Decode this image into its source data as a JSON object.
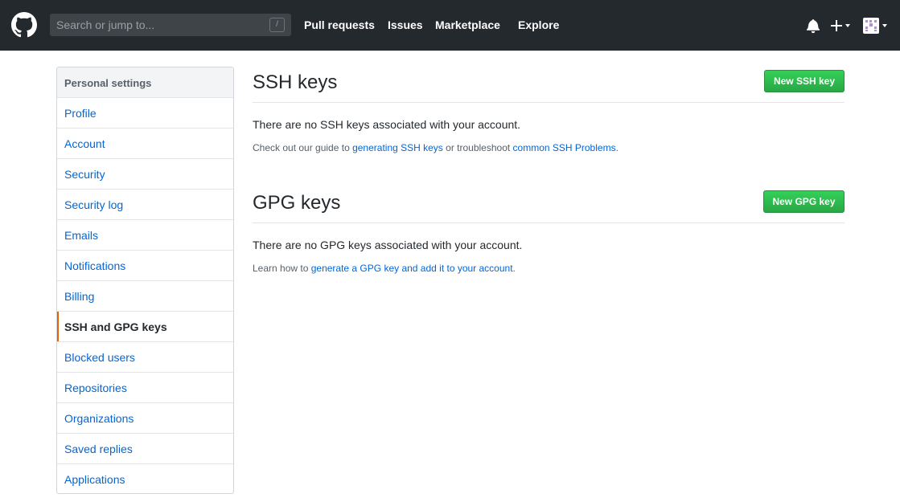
{
  "header": {
    "search_placeholder": "Search or jump to...",
    "search_shortcut": "/",
    "nav": [
      "Pull requests",
      "Issues",
      "Marketplace",
      "Explore"
    ],
    "icons": [
      "github-logo-icon",
      "bell-icon",
      "plus-icon",
      "avatar"
    ]
  },
  "sidebar": {
    "title": "Personal settings",
    "items": [
      {
        "label": "Profile",
        "selected": false
      },
      {
        "label": "Account",
        "selected": false
      },
      {
        "label": "Security",
        "selected": false
      },
      {
        "label": "Security log",
        "selected": false
      },
      {
        "label": "Emails",
        "selected": false
      },
      {
        "label": "Notifications",
        "selected": false
      },
      {
        "label": "Billing",
        "selected": false
      },
      {
        "label": "SSH and GPG keys",
        "selected": true
      },
      {
        "label": "Blocked users",
        "selected": false
      },
      {
        "label": "Repositories",
        "selected": false
      },
      {
        "label": "Organizations",
        "selected": false
      },
      {
        "label": "Saved replies",
        "selected": false
      },
      {
        "label": "Applications",
        "selected": false
      }
    ]
  },
  "ssh": {
    "title": "SSH keys",
    "button": "New SSH key",
    "empty": "There are no SSH keys associated with your account.",
    "note_prefix": "Check out our guide to ",
    "link1": "generating SSH keys",
    "note_middle": " or troubleshoot ",
    "link2": "common SSH Problems",
    "note_suffix": "."
  },
  "gpg": {
    "title": "GPG keys",
    "button": "New GPG key",
    "empty": "There are no GPG keys associated with your account.",
    "note_prefix": "Learn how to ",
    "link1": "generate a GPG key and add it to your account",
    "note_suffix": "."
  },
  "colors": {
    "header_bg": "#24292e",
    "link": "#0366d6",
    "accent_selected": "#e36209",
    "button_green": "#28a745"
  }
}
